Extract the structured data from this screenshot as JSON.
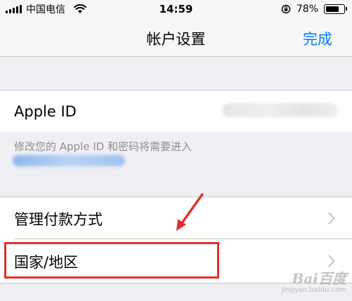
{
  "status_bar": {
    "carrier": "中国电信",
    "time": "14:59",
    "battery_percent": "78%",
    "battery_level": 0.78,
    "icons": [
      "signal-icon",
      "wifi-icon",
      "orientation-lock-icon",
      "battery-icon"
    ]
  },
  "nav": {
    "title": "帐户设置",
    "done_label": "完成",
    "accent_color": "#007aff"
  },
  "apple_id": {
    "label": "Apple ID"
  },
  "footer": {
    "text": "修改您的 Apple ID 和密码将需要进入"
  },
  "rows": [
    {
      "label": "管理付款方式",
      "icon": "chevron-right-icon"
    },
    {
      "label": "国家/地区",
      "icon": "chevron-right-icon"
    }
  ],
  "annotation": {
    "highlight_color": "#e0312d",
    "highlight_target": "国家/地区",
    "arrow_icon": "arrow-icon"
  },
  "watermark": {
    "logo": "Bai百度",
    "url": "jingyan.baidu.com"
  }
}
